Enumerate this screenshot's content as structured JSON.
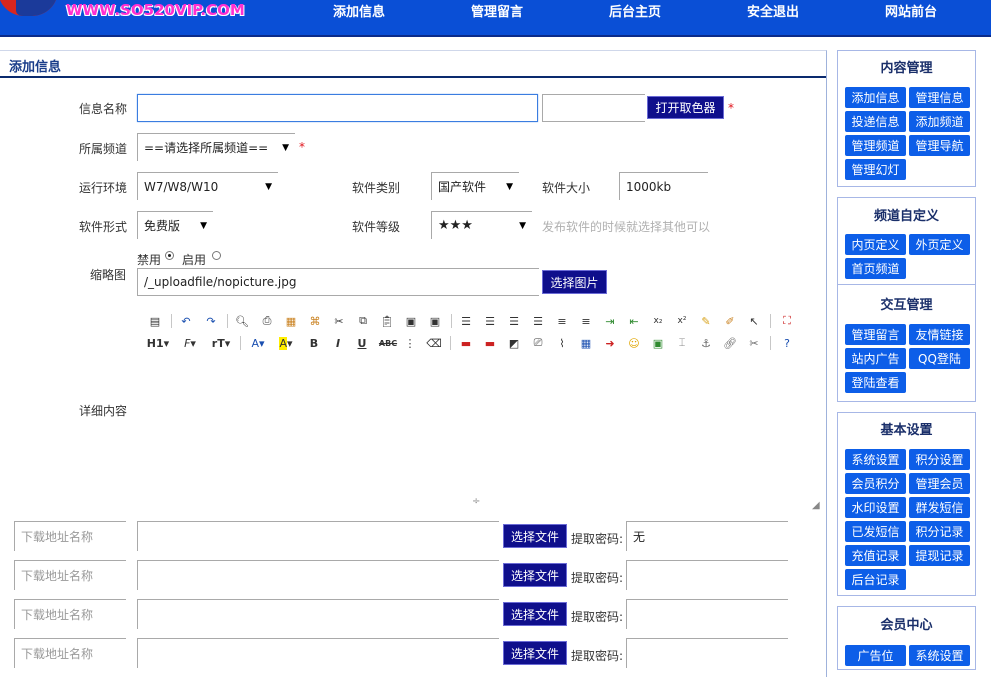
{
  "header": {
    "logo_text": "WWW.SO520VIP.COM",
    "nav": [
      "添加信息",
      "管理留言",
      "后台主页",
      "安全退出",
      "网站前台"
    ]
  },
  "main": {
    "panel_title": "添加信息",
    "form": {
      "info_name_label": "信息名称",
      "info_name_value": "",
      "color_value": "",
      "color_picker_button": "打开取色器",
      "required_mark": "*",
      "channel_label": "所属频道",
      "channel_value": "==请选择所属频道==",
      "env_label": "运行环境",
      "env_value": "W7/W8/W10",
      "software_type_label": "软件类别",
      "software_type_value": "国产软件",
      "software_size_label": "软件大小",
      "software_size_value": "1000kb",
      "software_form_label": "软件形式",
      "software_form_value": "免费版",
      "software_level_label": "软件等级",
      "software_level_value": "★★★",
      "software_level_hint": "发布软件的时候就选择其他可以",
      "thumbnail_label": "缩略图",
      "thumb_disable_label": "禁用",
      "thumb_enable_label": "启用",
      "thumbnail_path": "/_uploadfile/nopicture.jpg",
      "choose_image_button": "选择图片",
      "detail_label": "详细内容",
      "editor_row2_labels": [
        "H1",
        "F",
        "rT",
        "A",
        "A",
        "B",
        "I",
        "U",
        "ABC"
      ]
    },
    "downloads": [
      {
        "name_placeholder": "下载地址名称",
        "url": "",
        "choose_button": "选择文件",
        "pwd_label": "提取密码:",
        "pwd_value": "无"
      },
      {
        "name_placeholder": "下载地址名称",
        "url": "",
        "choose_button": "选择文件",
        "pwd_label": "提取密码:",
        "pwd_value": ""
      },
      {
        "name_placeholder": "下载地址名称",
        "url": "",
        "choose_button": "选择文件",
        "pwd_label": "提取密码:",
        "pwd_value": ""
      },
      {
        "name_placeholder": "下载地址名称",
        "url": "",
        "choose_button": "选择文件",
        "pwd_label": "提取密码:",
        "pwd_value": ""
      }
    ]
  },
  "sidebar": {
    "content_mgmt": {
      "title": "内容管理",
      "items": [
        "添加信息",
        "管理信息",
        "投递信息",
        "添加频道",
        "管理频道",
        "管理导航",
        "管理幻灯"
      ]
    },
    "channel_custom": {
      "title": "频道自定义",
      "items": [
        "内页定义",
        "外页定义",
        "首页频道"
      ]
    },
    "interact_mgmt": {
      "title": "交互管理",
      "items": [
        "管理留言",
        "友情链接",
        "站内广告",
        "QQ登陆",
        "登陆查看"
      ]
    },
    "basic_settings": {
      "title": "基本设置",
      "items": [
        "系统设置",
        "积分设置",
        "会员积分",
        "管理会员",
        "水印设置",
        "群发短信",
        "已发短信",
        "积分记录",
        "充值记录",
        "提现记录",
        "后台记录"
      ]
    },
    "member_center": {
      "title": "会员中心",
      "items": [
        "广告位",
        "系统设置"
      ]
    }
  },
  "colors": {
    "topbar": "#0a4fd6",
    "button_dark": "#0f0f8c",
    "sidebar_button": "#0d5ee8",
    "required": "#e0151d"
  }
}
